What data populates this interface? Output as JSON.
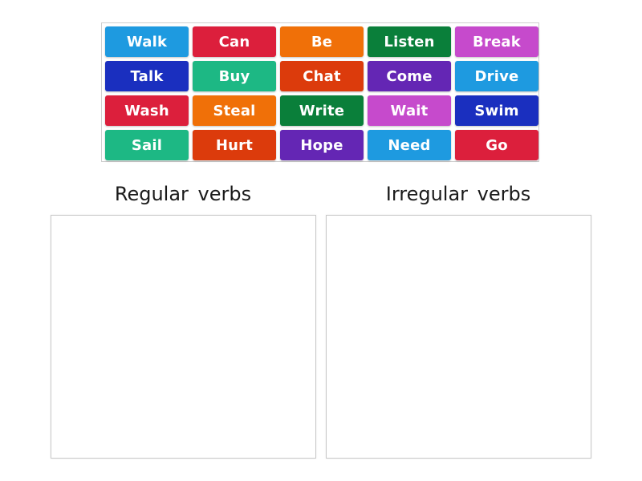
{
  "tiles": [
    {
      "label": "Walk",
      "color": "#1e9ae0"
    },
    {
      "label": "Can",
      "color": "#dc1f3c"
    },
    {
      "label": "Be",
      "color": "#f07008"
    },
    {
      "label": "Listen",
      "color": "#0a7f3a"
    },
    {
      "label": "Break",
      "color": "#c64acc"
    },
    {
      "label": "Talk",
      "color": "#1a2fbf"
    },
    {
      "label": "Buy",
      "color": "#1db884"
    },
    {
      "label": "Chat",
      "color": "#dc3b0c"
    },
    {
      "label": "Come",
      "color": "#6426b4"
    },
    {
      "label": "Drive",
      "color": "#1e9ae0"
    },
    {
      "label": "Wash",
      "color": "#dc1f3c"
    },
    {
      "label": "Steal",
      "color": "#f07008"
    },
    {
      "label": "Write",
      "color": "#0a7f3a"
    },
    {
      "label": "Wait",
      "color": "#c64acc"
    },
    {
      "label": "Swim",
      "color": "#1a2fbf"
    },
    {
      "label": "Sail",
      "color": "#1db884"
    },
    {
      "label": "Hurt",
      "color": "#dc3b0c"
    },
    {
      "label": "Hope",
      "color": "#6426b4"
    },
    {
      "label": "Need",
      "color": "#1e9ae0"
    },
    {
      "label": "Go",
      "color": "#dc1f3c"
    }
  ],
  "groups": {
    "regular": {
      "title": "Regular verbs"
    },
    "irregular": {
      "title": "Irregular verbs"
    }
  }
}
